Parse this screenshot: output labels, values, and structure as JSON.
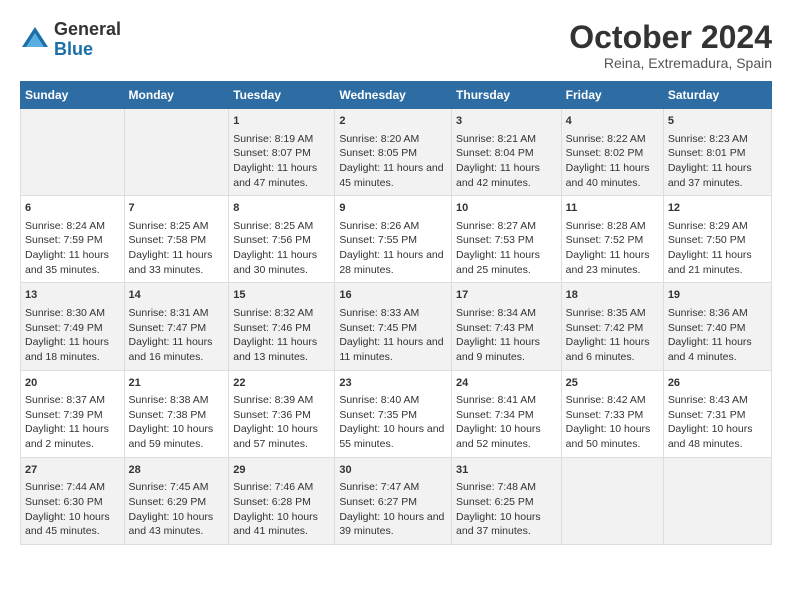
{
  "logo": {
    "general": "General",
    "blue": "Blue"
  },
  "title": {
    "month": "October 2024",
    "location": "Reina, Extremadura, Spain"
  },
  "headers": [
    "Sunday",
    "Monday",
    "Tuesday",
    "Wednesday",
    "Thursday",
    "Friday",
    "Saturday"
  ],
  "weeks": [
    [
      {
        "day": "",
        "info": ""
      },
      {
        "day": "",
        "info": ""
      },
      {
        "day": "1",
        "sunrise": "Sunrise: 8:19 AM",
        "sunset": "Sunset: 8:07 PM",
        "daylight": "Daylight: 11 hours and 47 minutes."
      },
      {
        "day": "2",
        "sunrise": "Sunrise: 8:20 AM",
        "sunset": "Sunset: 8:05 PM",
        "daylight": "Daylight: 11 hours and 45 minutes."
      },
      {
        "day": "3",
        "sunrise": "Sunrise: 8:21 AM",
        "sunset": "Sunset: 8:04 PM",
        "daylight": "Daylight: 11 hours and 42 minutes."
      },
      {
        "day": "4",
        "sunrise": "Sunrise: 8:22 AM",
        "sunset": "Sunset: 8:02 PM",
        "daylight": "Daylight: 11 hours and 40 minutes."
      },
      {
        "day": "5",
        "sunrise": "Sunrise: 8:23 AM",
        "sunset": "Sunset: 8:01 PM",
        "daylight": "Daylight: 11 hours and 37 minutes."
      }
    ],
    [
      {
        "day": "6",
        "sunrise": "Sunrise: 8:24 AM",
        "sunset": "Sunset: 7:59 PM",
        "daylight": "Daylight: 11 hours and 35 minutes."
      },
      {
        "day": "7",
        "sunrise": "Sunrise: 8:25 AM",
        "sunset": "Sunset: 7:58 PM",
        "daylight": "Daylight: 11 hours and 33 minutes."
      },
      {
        "day": "8",
        "sunrise": "Sunrise: 8:25 AM",
        "sunset": "Sunset: 7:56 PM",
        "daylight": "Daylight: 11 hours and 30 minutes."
      },
      {
        "day": "9",
        "sunrise": "Sunrise: 8:26 AM",
        "sunset": "Sunset: 7:55 PM",
        "daylight": "Daylight: 11 hours and 28 minutes."
      },
      {
        "day": "10",
        "sunrise": "Sunrise: 8:27 AM",
        "sunset": "Sunset: 7:53 PM",
        "daylight": "Daylight: 11 hours and 25 minutes."
      },
      {
        "day": "11",
        "sunrise": "Sunrise: 8:28 AM",
        "sunset": "Sunset: 7:52 PM",
        "daylight": "Daylight: 11 hours and 23 minutes."
      },
      {
        "day": "12",
        "sunrise": "Sunrise: 8:29 AM",
        "sunset": "Sunset: 7:50 PM",
        "daylight": "Daylight: 11 hours and 21 minutes."
      }
    ],
    [
      {
        "day": "13",
        "sunrise": "Sunrise: 8:30 AM",
        "sunset": "Sunset: 7:49 PM",
        "daylight": "Daylight: 11 hours and 18 minutes."
      },
      {
        "day": "14",
        "sunrise": "Sunrise: 8:31 AM",
        "sunset": "Sunset: 7:47 PM",
        "daylight": "Daylight: 11 hours and 16 minutes."
      },
      {
        "day": "15",
        "sunrise": "Sunrise: 8:32 AM",
        "sunset": "Sunset: 7:46 PM",
        "daylight": "Daylight: 11 hours and 13 minutes."
      },
      {
        "day": "16",
        "sunrise": "Sunrise: 8:33 AM",
        "sunset": "Sunset: 7:45 PM",
        "daylight": "Daylight: 11 hours and 11 minutes."
      },
      {
        "day": "17",
        "sunrise": "Sunrise: 8:34 AM",
        "sunset": "Sunset: 7:43 PM",
        "daylight": "Daylight: 11 hours and 9 minutes."
      },
      {
        "day": "18",
        "sunrise": "Sunrise: 8:35 AM",
        "sunset": "Sunset: 7:42 PM",
        "daylight": "Daylight: 11 hours and 6 minutes."
      },
      {
        "day": "19",
        "sunrise": "Sunrise: 8:36 AM",
        "sunset": "Sunset: 7:40 PM",
        "daylight": "Daylight: 11 hours and 4 minutes."
      }
    ],
    [
      {
        "day": "20",
        "sunrise": "Sunrise: 8:37 AM",
        "sunset": "Sunset: 7:39 PM",
        "daylight": "Daylight: 11 hours and 2 minutes."
      },
      {
        "day": "21",
        "sunrise": "Sunrise: 8:38 AM",
        "sunset": "Sunset: 7:38 PM",
        "daylight": "Daylight: 10 hours and 59 minutes."
      },
      {
        "day": "22",
        "sunrise": "Sunrise: 8:39 AM",
        "sunset": "Sunset: 7:36 PM",
        "daylight": "Daylight: 10 hours and 57 minutes."
      },
      {
        "day": "23",
        "sunrise": "Sunrise: 8:40 AM",
        "sunset": "Sunset: 7:35 PM",
        "daylight": "Daylight: 10 hours and 55 minutes."
      },
      {
        "day": "24",
        "sunrise": "Sunrise: 8:41 AM",
        "sunset": "Sunset: 7:34 PM",
        "daylight": "Daylight: 10 hours and 52 minutes."
      },
      {
        "day": "25",
        "sunrise": "Sunrise: 8:42 AM",
        "sunset": "Sunset: 7:33 PM",
        "daylight": "Daylight: 10 hours and 50 minutes."
      },
      {
        "day": "26",
        "sunrise": "Sunrise: 8:43 AM",
        "sunset": "Sunset: 7:31 PM",
        "daylight": "Daylight: 10 hours and 48 minutes."
      }
    ],
    [
      {
        "day": "27",
        "sunrise": "Sunrise: 7:44 AM",
        "sunset": "Sunset: 6:30 PM",
        "daylight": "Daylight: 10 hours and 45 minutes."
      },
      {
        "day": "28",
        "sunrise": "Sunrise: 7:45 AM",
        "sunset": "Sunset: 6:29 PM",
        "daylight": "Daylight: 10 hours and 43 minutes."
      },
      {
        "day": "29",
        "sunrise": "Sunrise: 7:46 AM",
        "sunset": "Sunset: 6:28 PM",
        "daylight": "Daylight: 10 hours and 41 minutes."
      },
      {
        "day": "30",
        "sunrise": "Sunrise: 7:47 AM",
        "sunset": "Sunset: 6:27 PM",
        "daylight": "Daylight: 10 hours and 39 minutes."
      },
      {
        "day": "31",
        "sunrise": "Sunrise: 7:48 AM",
        "sunset": "Sunset: 6:25 PM",
        "daylight": "Daylight: 10 hours and 37 minutes."
      },
      {
        "day": "",
        "info": ""
      },
      {
        "day": "",
        "info": ""
      }
    ]
  ]
}
